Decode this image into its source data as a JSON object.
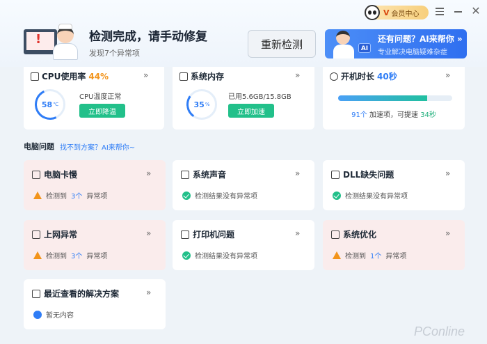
{
  "titlebar": {
    "vip_mark": "V",
    "vip_label": "会员中心"
  },
  "hero": {
    "title": "检测完成，请手动修复",
    "subtitle": "发现7个异常项",
    "rescan_label": "重新检测",
    "ai_banner": {
      "tag": "AI",
      "title": "还有问题？AI来帮你 »",
      "subtitle": "专业解决电脑疑难杂症"
    }
  },
  "stats": {
    "cpu": {
      "title": "CPU使用率",
      "value": "44%",
      "ring_value": "58",
      "ring_unit": "℃",
      "desc": "CPU温度正常",
      "button": "立即降温"
    },
    "memory": {
      "title": "系统内存",
      "ring_value": "35",
      "ring_unit": "%",
      "desc": "已用5.6GB/15.8GB",
      "button": "立即加速"
    },
    "boot": {
      "title": "开机时长",
      "value": "40秒",
      "progress": 0.78,
      "count": "91个",
      "middle": "加速项，可提速",
      "save": "34秒"
    }
  },
  "section": {
    "title": "电脑问题",
    "link": "找不到方案？AI来帮你~"
  },
  "issues": [
    {
      "title": "电脑卡慢",
      "status": "warn",
      "prefix": "检测到",
      "count": "3个",
      "suffix": "异常项",
      "icon": "monitor-icon"
    },
    {
      "title": "系统声音",
      "status": "ok",
      "text": "检测结果没有异常项",
      "icon": "speaker-icon"
    },
    {
      "title": "DLL缺失问题",
      "status": "ok",
      "text": "检测结果没有异常项",
      "icon": "file-icon"
    },
    {
      "title": "上网异常",
      "status": "warn",
      "prefix": "检测到",
      "count": "3个",
      "suffix": "异常项",
      "icon": "wifi-icon"
    },
    {
      "title": "打印机问题",
      "status": "ok",
      "text": "检测结果没有异常项",
      "icon": "printer-icon"
    },
    {
      "title": "系统优化",
      "status": "warn",
      "prefix": "检测到",
      "count": "1个",
      "suffix": "异常项",
      "icon": "optimize-icon"
    }
  ],
  "recent": {
    "title": "最近查看的解决方案",
    "empty": "暂无内容"
  },
  "watermark": "PConline",
  "colors": {
    "accent": "#2f7df6",
    "green": "#22c08a",
    "warn": "#f2941b",
    "warn_bg": "#faecec"
  }
}
